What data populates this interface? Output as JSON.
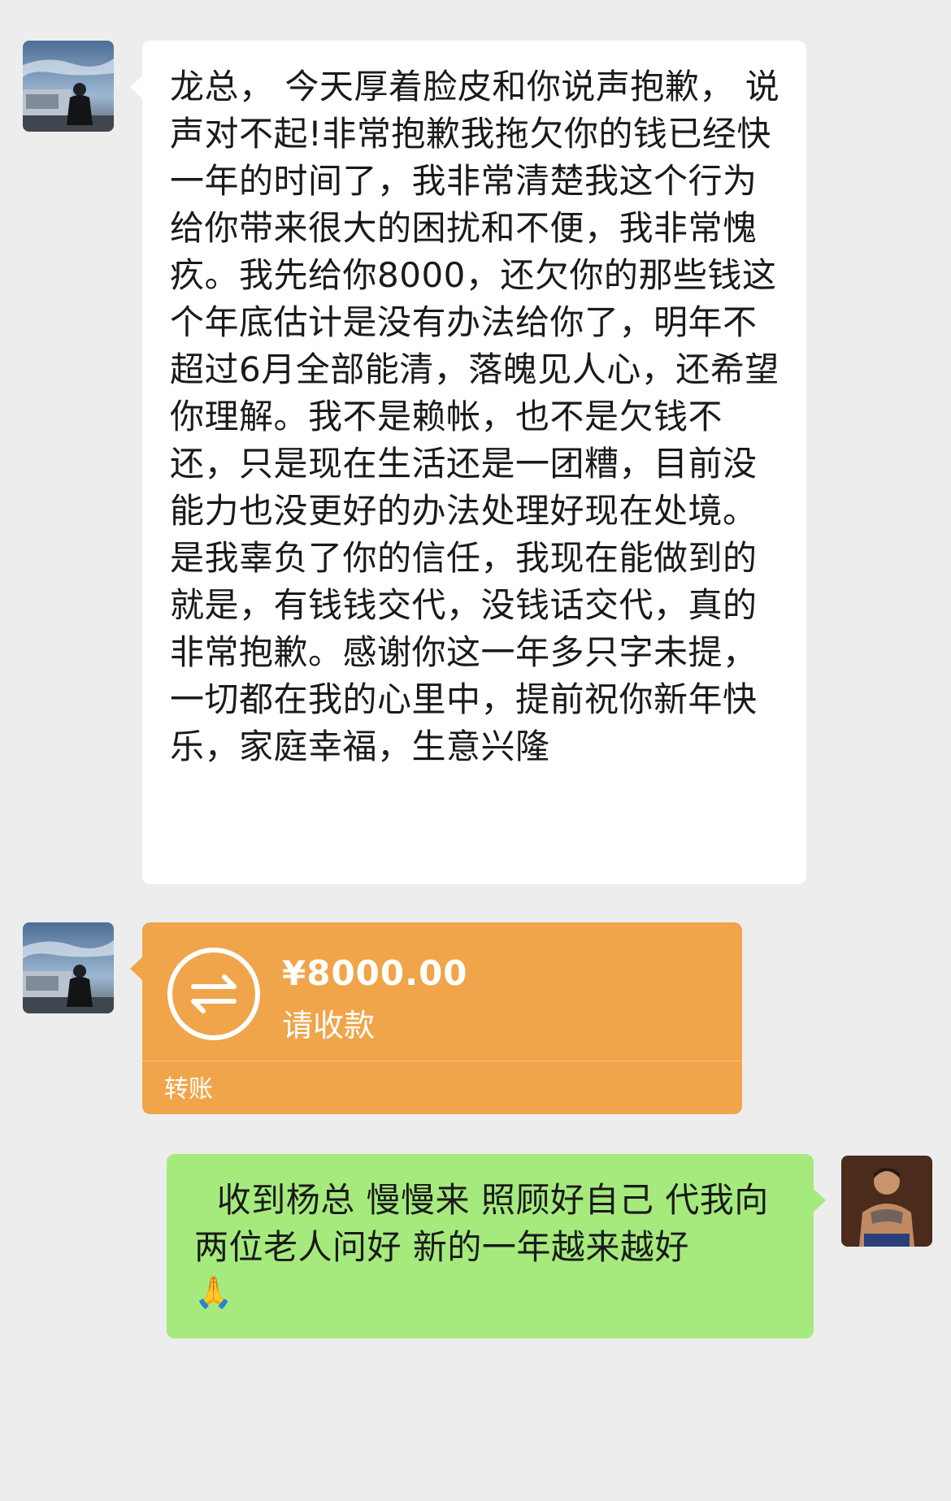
{
  "messages": {
    "incoming_text": {
      "text": "龙总， 今天厚着脸皮和你说声抱歉， 说声对不起!非常抱歉我拖欠你的钱已经快一年的时间了，我非常清楚我这个行为给你带来很大的困扰和不便，我非常愧疚。我先给你8000，还欠你的那些钱这个年底估计是没有办法给你了，明年不超过6月全部能清，落魄见人心，还希望你理解。我不是赖帐，也不是欠钱不还，只是现在生活还是一团糟，目前没能力也没更好的办法处理好现在处境。是我辜负了你的信任，我现在能做到的就是，有钱钱交代，没钱话交代，真的非常抱歉。感谢你这一年多只字未提，一切都在我的心里中，提前祝你新年快乐，家庭幸福，生意兴隆"
    },
    "transfer": {
      "amount": "¥8000.00",
      "description": "请收款",
      "footer": "转账",
      "color": "#f0a54a"
    },
    "outgoing_reply": {
      "text": "  收到杨总 慢慢来 照顾好自己 代我向两位老人问好 新的一年越来越好",
      "emoji": "🙏",
      "color": "#a6ea7e"
    }
  },
  "avatars": {
    "sender": "sender-avatar",
    "receiver": "receiver-avatar"
  }
}
